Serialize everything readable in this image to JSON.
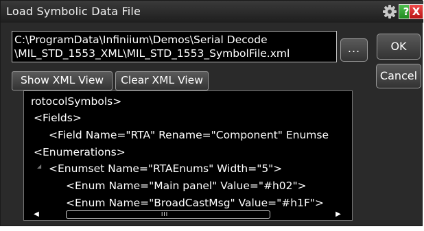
{
  "dialog": {
    "title": "Load Symbolic Data File",
    "icons": {
      "settings": "gear-icon",
      "help": "help-icon",
      "close": "close-icon"
    },
    "help_label": "?",
    "close_label": "X"
  },
  "file_path": {
    "line1": "C:\\ProgramData\\Infiniium\\Demos\\Serial Decode",
    "line2": "\\MIL_STD_1553_XML\\MIL_STD_1553_SymbolFile.xml"
  },
  "buttons": {
    "browse": "...",
    "ok": "OK",
    "cancel": "Cancel",
    "show_xml": "Show XML View",
    "clear_xml": "Clear XML View"
  },
  "xml_view": {
    "lines": [
      "rotocolSymbols>",
      "<Fields>",
      "<Field Name=\"RTA\" Rename=\"Component\" Enumse",
      "<Enumerations>",
      "<Enumset Name=\"RTAEnums\" Width=\"5\">",
      "<Enum Name=\"Main panel\" Value=\"#h02\">",
      "<Enum Name=\"BroadCastMsg\" Value=\"#h1F\">"
    ],
    "expander_glyph": "◢",
    "scroll_left": "◀",
    "scroll_right": "▶",
    "thumb_grip": "III"
  },
  "colors": {
    "dialog_bg": "#2a2a2a",
    "text": "#ffffff",
    "help_green": "#1f8a1f",
    "close_red": "#b81414"
  }
}
